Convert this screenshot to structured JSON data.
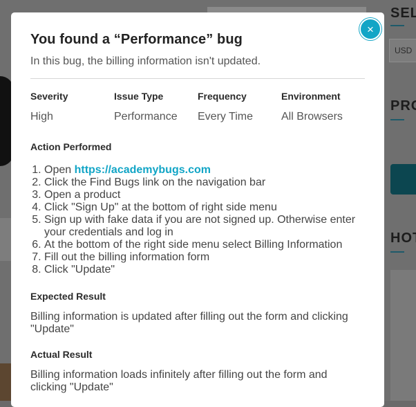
{
  "background": {
    "side_titles": [
      "SEL",
      "PRO",
      "HOT"
    ],
    "currency": "USD"
  },
  "modal": {
    "title": "You found a “Performance” bug",
    "subtitle": "In this bug, the billing information isn't updated.",
    "close_icon": "×",
    "details": [
      {
        "label": "Severity",
        "value": "High"
      },
      {
        "label": "Issue Type",
        "value": "Performance"
      },
      {
        "label": "Frequency",
        "value": "Every Time"
      },
      {
        "label": "Environment",
        "value": "All Browsers"
      }
    ],
    "action_title": "Action Performed",
    "steps": {
      "step1_prefix": "Open ",
      "step1_link": "https://academybugs.com",
      "step2": "Click the Find Bugs link on the navigation bar",
      "step3": "Open a product",
      "step4": "Click \"Sign Up\" at the bottom of right side menu",
      "step5": "Sign up with fake data if you are not signed up. Otherwise enter your credentials and log in",
      "step6": "At the bottom of the right side menu select Billing Information",
      "step7": "Fill out the billing information form",
      "step8": "Click \"Update\""
    },
    "expected_title": "Expected Result",
    "expected_text": "Billing information is updated after filling out the form and clicking \"Update\"",
    "actual_title": "Actual Result",
    "actual_text": "Billing information loads infinitely after filling out the form and clicking \"Update\""
  }
}
